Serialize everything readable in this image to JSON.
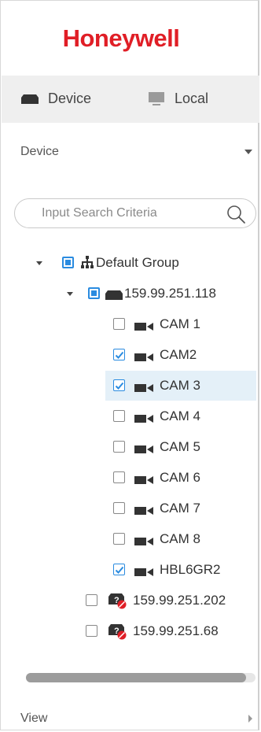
{
  "brand": {
    "logo_text": "Honeywell",
    "logo_color": "#e01e26"
  },
  "tabs": [
    {
      "label": "Device",
      "icon": "device-icon",
      "active": true
    },
    {
      "label": "Local",
      "icon": "monitor-icon",
      "active": false
    }
  ],
  "device_dropdown": {
    "label": "Device"
  },
  "search": {
    "placeholder": "Input Search Criteria",
    "value": ""
  },
  "tree": {
    "group": {
      "label": "Default Group",
      "icon": "network-icon",
      "checkbox": "partial",
      "expanded": true
    },
    "nvr": {
      "label": "159.99.251.118",
      "icon": "nvr-icon",
      "checkbox": "partial",
      "expanded": true
    },
    "cameras": [
      {
        "label": "CAM 1",
        "checked": false,
        "selected": false
      },
      {
        "label": "CAM2",
        "checked": true,
        "selected": false
      },
      {
        "label": "CAM 3",
        "checked": true,
        "selected": true
      },
      {
        "label": "CAM 4",
        "checked": false,
        "selected": false
      },
      {
        "label": "CAM 5",
        "checked": false,
        "selected": false
      },
      {
        "label": "CAM 6",
        "checked": false,
        "selected": false
      },
      {
        "label": "CAM 7",
        "checked": false,
        "selected": false
      },
      {
        "label": "CAM 8",
        "checked": false,
        "selected": false
      },
      {
        "label": "HBL6GR2",
        "checked": true,
        "selected": false
      }
    ],
    "offline_devices": [
      {
        "label": "159.99.251.202",
        "icon": "offline-device-icon",
        "checked": false
      },
      {
        "label": "159.99.251.68",
        "icon": "offline-device-icon",
        "checked": false
      }
    ]
  },
  "view_dropdown": {
    "label": "View"
  },
  "colors": {
    "accent": "#2a8be0",
    "selected_row": "#e4f0f8",
    "tab_bar": "#efefef"
  }
}
